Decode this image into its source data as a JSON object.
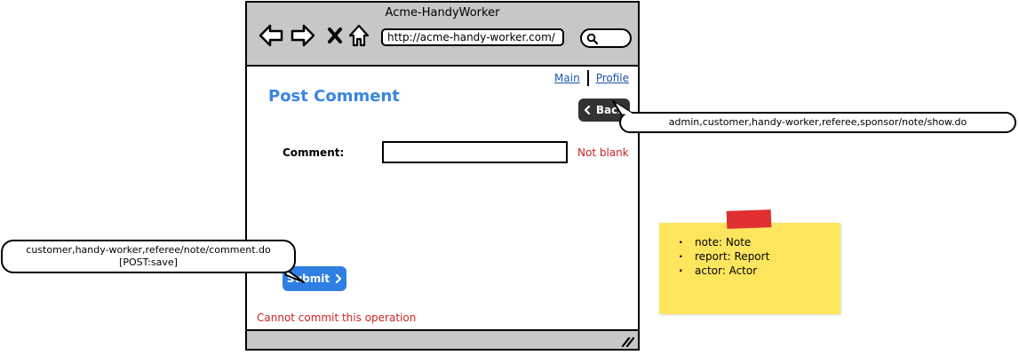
{
  "window": {
    "title": "Acme-HandyWorker",
    "url": "http://acme-handy-worker.com/"
  },
  "nav": {
    "main": "Main",
    "profile": "Profile"
  },
  "page": {
    "title": "Post Comment",
    "back_label": "Back",
    "comment_label": "Comment:",
    "comment_value": "",
    "not_blank": "Not blank",
    "submit_label": "Submit",
    "error": "Cannot commit this operation"
  },
  "callouts": {
    "back": "admin,customer,handy-worker,referee,sponsor/note/show.do",
    "submit_line1": "customer,handy-worker,referee/note/comment.do",
    "submit_line2": "[POST:save]"
  },
  "sticky_note": {
    "items": [
      "note: Note",
      "report: Report",
      "actor: Actor"
    ]
  },
  "colors": {
    "titlebar": "#c7c7c7",
    "title_blue": "#3a85e0",
    "link_blue": "#1a56a8",
    "error_red": "#cc2222",
    "submit_blue": "#2f7fe3",
    "back_dark": "#333333",
    "sticky_yellow": "#fde65e",
    "tape_red": "#e03030"
  }
}
